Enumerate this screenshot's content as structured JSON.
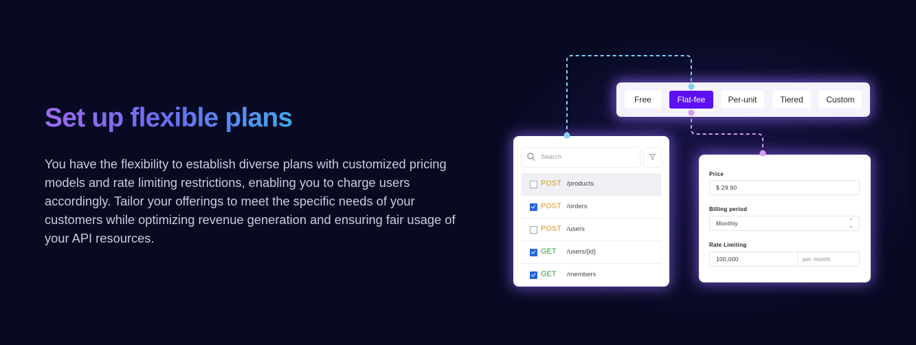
{
  "hero": {
    "title": "Set up flexible plans",
    "description": "You have the flexibility to establish diverse plans with customized pricing models and rate limiting restrictions, enabling you to charge users accordingly. Tailor your offerings to meet the specific needs of your customers while optimizing revenue generation and ensuring fair usage of your API resources."
  },
  "pricing_models": {
    "tabs": [
      {
        "label": "Free",
        "active": false
      },
      {
        "label": "Flat-fee",
        "active": true
      },
      {
        "label": "Per-unit",
        "active": false
      },
      {
        "label": "Tiered",
        "active": false
      },
      {
        "label": "Custom",
        "active": false
      }
    ],
    "active_color": "#5b0ff2"
  },
  "endpoints": {
    "search_placeholder": "Search",
    "rows": [
      {
        "method": "POST",
        "path": "/products",
        "checked": false,
        "highlighted": true
      },
      {
        "method": "POST",
        "path": "/orders",
        "checked": true,
        "highlighted": false
      },
      {
        "method": "POST",
        "path": "/users",
        "checked": false,
        "highlighted": false
      },
      {
        "method": "GET",
        "path": "/users/{id}",
        "checked": true,
        "highlighted": false
      },
      {
        "method": "GET",
        "path": "/members",
        "checked": true,
        "highlighted": false
      }
    ]
  },
  "plan_form": {
    "price_label": "Price",
    "price_value": "$ 29.90",
    "billing_label": "Billing period",
    "billing_value": "Monthly",
    "rate_label": "Rate Limiting",
    "rate_value": "100,000",
    "rate_unit": "per month"
  },
  "colors": {
    "background": "#080a24",
    "connector_blue": "#7fd0f5",
    "connector_purple": "#d49af5"
  }
}
